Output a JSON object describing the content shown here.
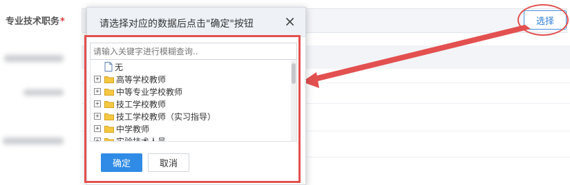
{
  "form": {
    "field_label": "专业技术职务",
    "required_mark": "*",
    "select_button": "选择"
  },
  "dialog": {
    "title": "请选择对应的数据后点击\"确定\"按钮",
    "close_icon": "×",
    "search_placeholder": "请输入关键字进行模糊查询..",
    "tree": [
      {
        "label": "无",
        "type": "file",
        "expandable": false
      },
      {
        "label": "高等学校教师",
        "type": "folder",
        "expandable": true
      },
      {
        "label": "中等专业学校教师",
        "type": "folder",
        "expandable": true
      },
      {
        "label": "技工学校教师",
        "type": "folder",
        "expandable": true
      },
      {
        "label": "技工学校教师（实习指导）",
        "type": "folder",
        "expandable": true
      },
      {
        "label": "中学教师",
        "type": "folder",
        "expandable": true
      },
      {
        "label": "实验技术人员",
        "type": "folder",
        "expandable": true
      }
    ],
    "ok_button": "确定",
    "cancel_button": "取消"
  },
  "colors": {
    "annotation": "#e35050",
    "primary": "#2f8be6",
    "folder": "#f5c842"
  }
}
